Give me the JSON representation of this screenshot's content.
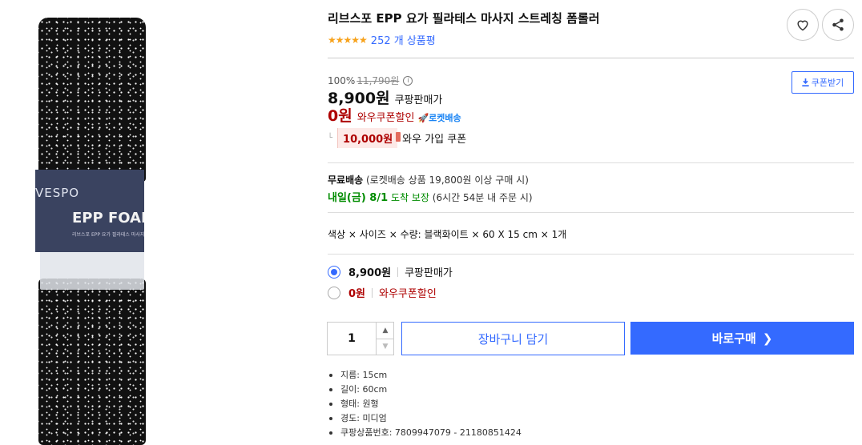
{
  "product": {
    "title": "리브스포 EPP 요가 필라테스 마사지 스트레칭 폼롤러",
    "image_brand": "VESPO",
    "image_title": "EPP FOAM",
    "image_subtitle": "리브스포 EPP 요가 필라테스 마사지"
  },
  "rating": {
    "stars": "★★★★★",
    "review_count": "252 개 상품평"
  },
  "price": {
    "discount_rate": "100%",
    "original_price": "11,790원",
    "coupon_button": "쿠폰받기",
    "sale_price": "8,900원",
    "sale_label": "쿠팡판매가",
    "wow_price": "0원",
    "wow_label": "와우쿠폰할인",
    "rocket_label": "로켓배송",
    "join_coupon_amount": "10,000원",
    "join_coupon_label": "와우 가입 쿠폰"
  },
  "shipping": {
    "free_label": "무료배송",
    "free_note": "(로켓배송 상품 19,800원 이상 구매 시)",
    "arrival_date": "내일(금) 8/1",
    "arrival_suffix": "도착 보장",
    "arrival_note": "(6시간 54분 내 주문 시)"
  },
  "option": {
    "text": "색상 × 사이즈 × 수량: 블랙화이트 × 60 X 15 cm × 1개"
  },
  "price_options": [
    {
      "price": "8,900원",
      "label": "쿠팡판매가",
      "selected": true
    },
    {
      "price": "0원",
      "label": "와우쿠폰할인",
      "selected": false
    }
  ],
  "purchase": {
    "quantity": "1",
    "cart_button": "장바구니 담기",
    "buy_button": "바로구매"
  },
  "specs": [
    "지름: 15cm",
    "길이: 60cm",
    "형태: 원형",
    "경도: 미디엄",
    "쿠팡상품번호: 7809947079 - 21180851424"
  ],
  "colors": {
    "accent": "#346aff",
    "wow_red": "#ae0000",
    "arrival_green": "#008c00",
    "star": "#f7a21b"
  }
}
